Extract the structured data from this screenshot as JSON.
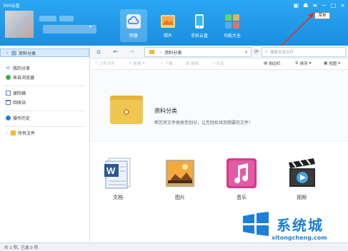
{
  "app": {
    "title": "360云盘"
  },
  "nav": [
    {
      "label": "网盘"
    },
    {
      "label": "照片"
    },
    {
      "label": "手机云盘"
    },
    {
      "label": "功能大全"
    }
  ],
  "tooltip": "菜单",
  "sidebar": {
    "items": [
      {
        "label": "资料分类"
      },
      {
        "label": "我的分享"
      },
      {
        "label": "来自浏览器"
      },
      {
        "label": "保险箱"
      },
      {
        "label": "回收站"
      },
      {
        "label": "操作历史"
      },
      {
        "label": "所有文件"
      }
    ]
  },
  "address": {
    "path": "资料分类",
    "search_placeholder": "搜索全部文件"
  },
  "toolbar": {
    "upload": "上传文件",
    "new": "新建",
    "download": "下载",
    "delete": "删除",
    "share": "分享",
    "sidebar_toggle": "侧边栏",
    "sort": "排序",
    "view": "视图"
  },
  "banner": {
    "title": "资料分类",
    "subtitle": "帮您将文件按类型划分，让您轻松找到想要的文件！"
  },
  "categories": [
    {
      "label": "文档"
    },
    {
      "label": "图片"
    },
    {
      "label": "音乐"
    },
    {
      "label": "视频"
    }
  ],
  "status": {
    "text": "共 1 项，已选 0 项"
  },
  "watermark": {
    "brand": "系统城",
    "url": "xitongcheng.com"
  },
  "colors": {
    "header": "#1b8fe0",
    "accent": "#2a7ed1",
    "active_row": "#d9ebfb"
  }
}
